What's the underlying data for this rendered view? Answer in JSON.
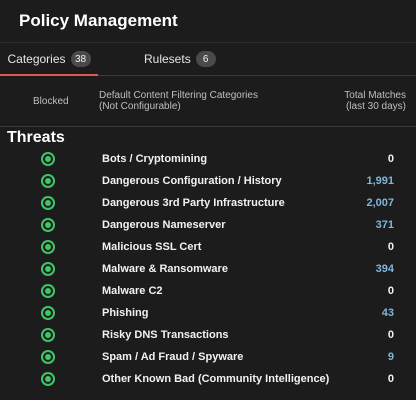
{
  "title": "Policy Management",
  "tabs": [
    {
      "label": "Categories",
      "count": "38"
    },
    {
      "label": "Rulesets",
      "count": "6"
    }
  ],
  "headers": {
    "blocked": "Blocked",
    "categories_line1": "Default Content Filtering Categories",
    "categories_line2": "(Not Configurable)",
    "matches_line1": "Total Matches",
    "matches_line2": "(last 30 days)"
  },
  "section": "Threats",
  "rows": [
    {
      "name": "Bots / Cryptomining",
      "matches": "0"
    },
    {
      "name": "Dangerous Configuration / History",
      "matches": "1,991"
    },
    {
      "name": "Dangerous 3rd Party Infrastructure",
      "matches": "2,007"
    },
    {
      "name": "Dangerous Nameserver",
      "matches": "371"
    },
    {
      "name": "Malicious SSL Cert",
      "matches": "0"
    },
    {
      "name": "Malware & Ransomware",
      "matches": "394"
    },
    {
      "name": "Malware C2",
      "matches": "0"
    },
    {
      "name": "Phishing",
      "matches": "43"
    },
    {
      "name": "Risky DNS Transactions",
      "matches": "0"
    },
    {
      "name": "Spam / Ad Fraud / Spyware",
      "matches": "9"
    },
    {
      "name": "Other Known Bad (Community Intelligence)",
      "matches": "0"
    }
  ],
  "colors": {
    "accent": "#e05757",
    "status_green": "#3fc56a",
    "link_blue": "#7fb6d9"
  }
}
